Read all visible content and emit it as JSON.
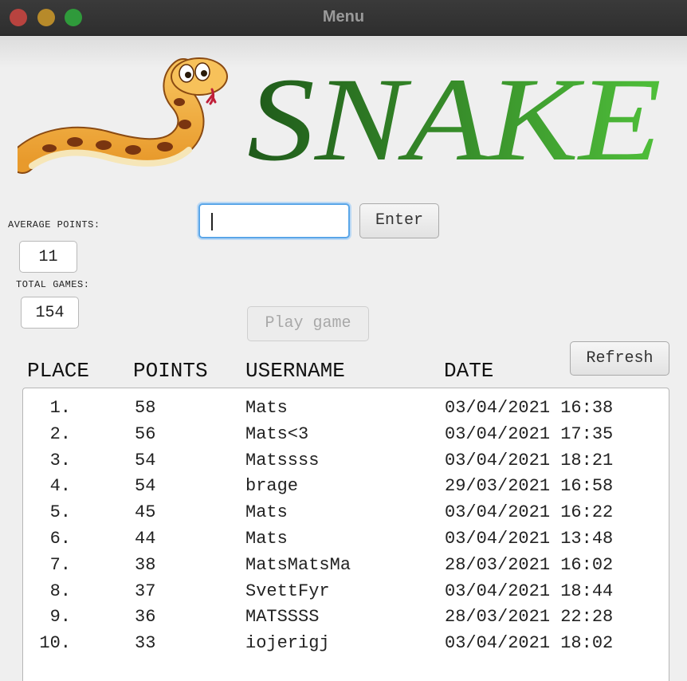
{
  "window": {
    "title": "Menu"
  },
  "logo": {
    "text": "SNAKE"
  },
  "stats": {
    "average_label": "AVERAGE POINTS:",
    "average_value": "11",
    "total_label": "TOTAL GAMES:",
    "total_value": "154"
  },
  "name_input": {
    "value": "",
    "placeholder": ""
  },
  "buttons": {
    "enter": "Enter",
    "play": "Play game",
    "refresh": "Refresh"
  },
  "table": {
    "headers": [
      "PLACE",
      "POINTS",
      "USERNAME",
      "DATE"
    ],
    "rows": [
      {
        "place": "1.",
        "points": "58",
        "username": "Mats",
        "date": "03/04/2021 16:38"
      },
      {
        "place": "2.",
        "points": "56",
        "username": "Mats<3",
        "date": "03/04/2021 17:35"
      },
      {
        "place": "3.",
        "points": "54",
        "username": "Matssss",
        "date": "03/04/2021 18:21"
      },
      {
        "place": "4.",
        "points": "54",
        "username": "brage",
        "date": "29/03/2021 16:58"
      },
      {
        "place": "5.",
        "points": "45",
        "username": "Mats",
        "date": "03/04/2021 16:22"
      },
      {
        "place": "6.",
        "points": "44",
        "username": "Mats",
        "date": "03/04/2021 13:48"
      },
      {
        "place": "7.",
        "points": "38",
        "username": "MatsMatsMa",
        "date": "28/03/2021 16:02"
      },
      {
        "place": "8.",
        "points": "37",
        "username": "SvettFyr",
        "date": "03/04/2021 18:44"
      },
      {
        "place": "9.",
        "points": "36",
        "username": "MATSSSS",
        "date": "28/03/2021 22:28"
      },
      {
        "place": "10.",
        "points": "33",
        "username": "iojerigj",
        "date": "03/04/2021 18:02"
      }
    ]
  },
  "colors": {
    "accent_focus": "#5aa6e8",
    "logo_green_dark": "#1f5a1a",
    "logo_green_light": "#4fbf3a",
    "snake_orange": "#f1a93a"
  }
}
